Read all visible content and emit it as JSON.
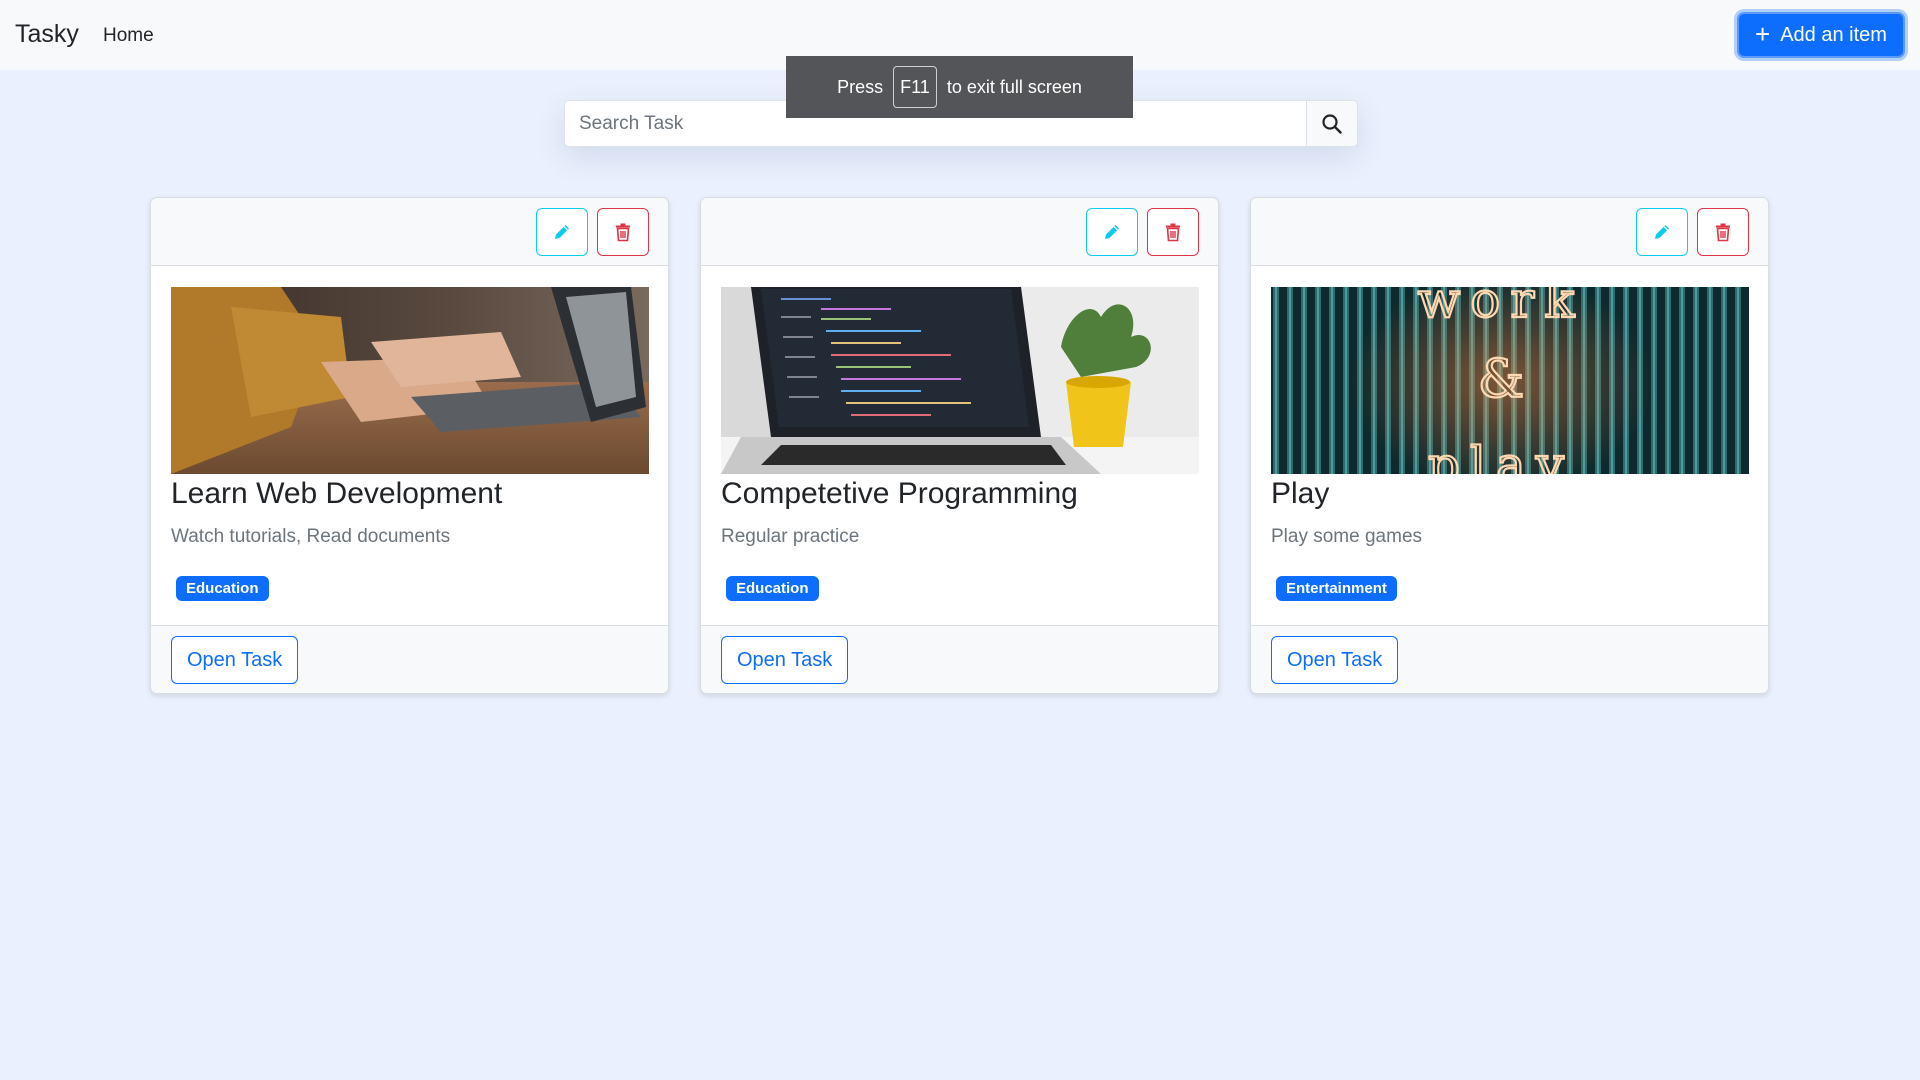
{
  "navbar": {
    "brand": "Tasky",
    "home_label": "Home",
    "add_label": "Add an item"
  },
  "search": {
    "placeholder": "Search Task"
  },
  "toast": {
    "press": "Press",
    "key": "F11",
    "message": "to exit full screen"
  },
  "cards": [
    {
      "title": "Learn Web Development",
      "description": "Watch tutorials, Read documents",
      "tag": "Education",
      "open_label": "Open Task"
    },
    {
      "title": "Competetive Programming",
      "description": "Regular practice",
      "tag": "Education",
      "open_label": "Open Task"
    },
    {
      "title": "Play",
      "description": "Play some games",
      "tag": "Entertainment",
      "open_label": "Open Task"
    }
  ],
  "image_texts": {
    "neon_line1": "work",
    "neon_line2": "&",
    "neon_line3": "play"
  },
  "colors": {
    "primary": "#0d6efd",
    "info": "#0dcaf0",
    "danger": "#dc3545",
    "background": "#eaf0fd"
  }
}
